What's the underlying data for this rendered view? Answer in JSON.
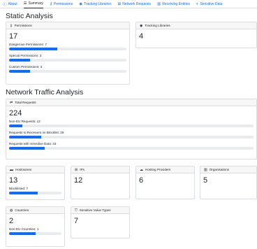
{
  "nav": {
    "tabs": [
      {
        "label": "About",
        "icon": "info-icon"
      },
      {
        "label": "Summary",
        "icon": "list-icon"
      },
      {
        "label": "Permissions",
        "icon": "key-icon"
      },
      {
        "label": "Tracking Libraries",
        "icon": "eye-icon"
      },
      {
        "label": "Network Requests",
        "icon": "network-icon"
      },
      {
        "label": "Receiving Entities",
        "icon": "building-icon"
      },
      {
        "label": "Sensitive Data",
        "icon": "half-circle-icon"
      }
    ],
    "active": "Summary"
  },
  "static_analysis": {
    "heading": "Static Analysis",
    "permissions": {
      "title": "Permissions",
      "count": "17",
      "dangerous": {
        "label": "Dangerous Permissions: 7",
        "fraction": 0.41
      },
      "special": {
        "label": "Special Permissions: 3",
        "fraction": 0.18
      },
      "custom": {
        "label": "Custom Permissions: 3",
        "fraction": 0.18
      }
    },
    "tracking": {
      "title": "Tracking Libraries",
      "count": "4"
    }
  },
  "network_analysis": {
    "heading": "Network Traffic Analysis",
    "total": {
      "title": "Total Requests",
      "count": "224",
      "non_eu": {
        "label": "Non-EU Requests: 12",
        "fraction": 0.054
      },
      "blocklist": {
        "label": "Requests to Receivers on Blocklist: 29",
        "fraction": 0.13
      },
      "sensitive": {
        "label": "Requests with Sensitive Data: 33",
        "fraction": 0.147
      }
    },
    "hostnames": {
      "title": "Hostnames",
      "count": "13",
      "blocked": {
        "label": "Blocklisted: 7",
        "fraction": 0.54
      }
    },
    "ips": {
      "title": "IPs",
      "count": "12"
    },
    "hosting": {
      "title": "Hosting Providers",
      "count": "6"
    },
    "orgs": {
      "title": "Organisations",
      "count": "5"
    },
    "countries": {
      "title": "Countries",
      "count": "2",
      "non_eu": {
        "label": "Non-EU Countries: 1",
        "fraction": 0.5
      }
    },
    "sensitive_types": {
      "title": "Sensitive Value Types",
      "count": "7"
    }
  }
}
